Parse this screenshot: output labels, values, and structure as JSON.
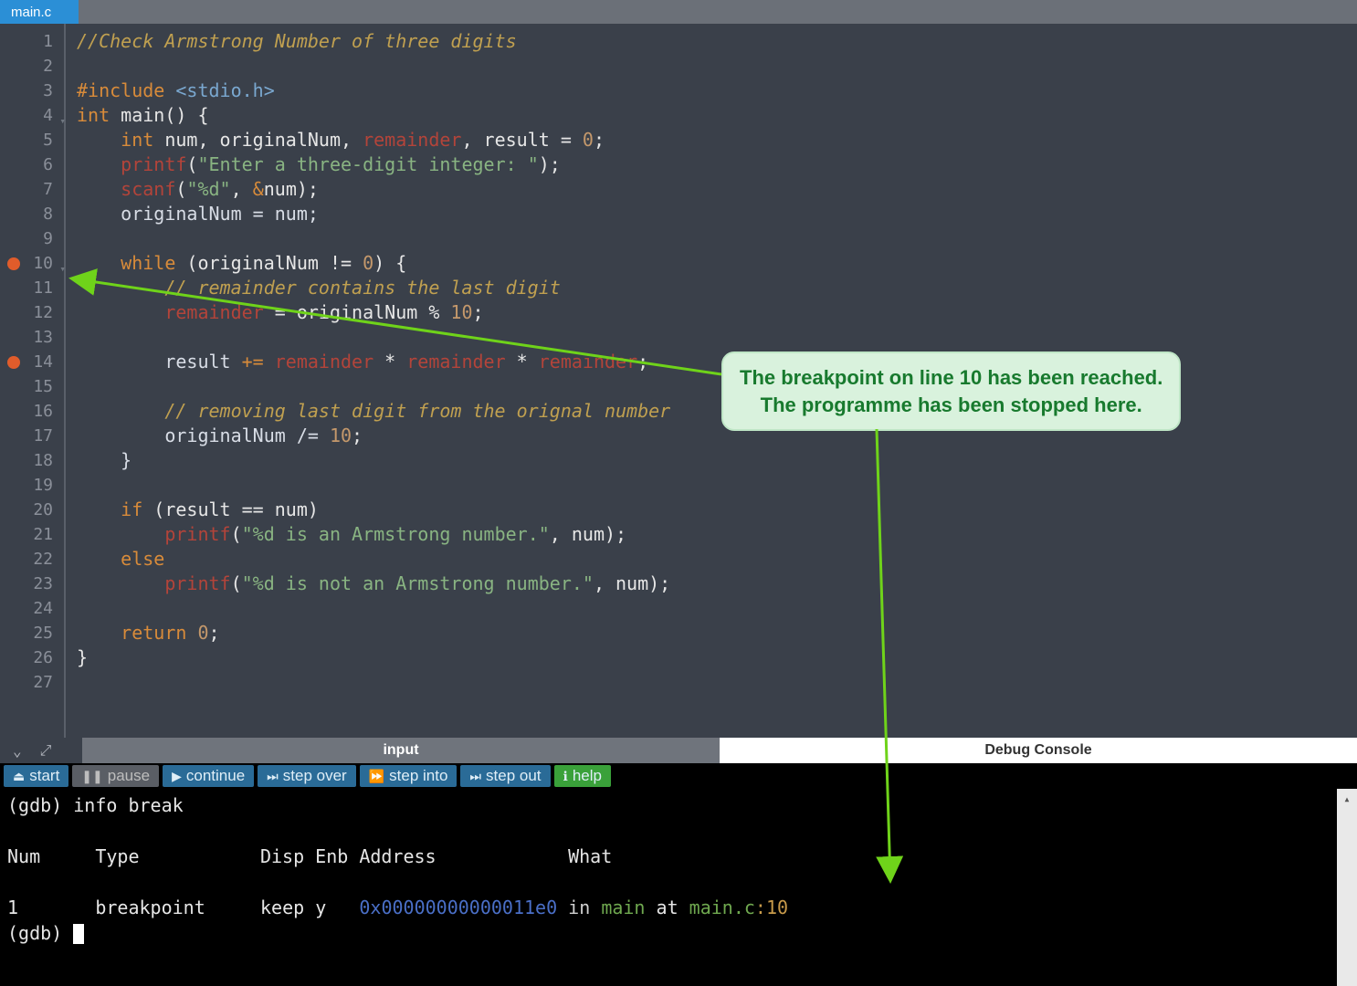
{
  "tab": {
    "filename": "main.c"
  },
  "code": {
    "lines": [
      {
        "n": 1,
        "segs": [
          [
            "c-comment",
            "//Check Armstrong Number of three digits"
          ]
        ]
      },
      {
        "n": 2,
        "segs": []
      },
      {
        "n": 3,
        "segs": [
          [
            "c-pp",
            "#include "
          ],
          [
            "c-ppfile",
            "<stdio.h>"
          ]
        ]
      },
      {
        "n": 4,
        "fold": true,
        "segs": [
          [
            "c-kw",
            "int "
          ],
          [
            "c-ident",
            "main() {"
          ]
        ]
      },
      {
        "n": 5,
        "segs": [
          [
            "",
            "    "
          ],
          [
            "c-kw",
            "int "
          ],
          [
            "c-ident",
            "num, originalNum, "
          ],
          [
            "c-red",
            "remainder"
          ],
          [
            "c-ident",
            ", result = "
          ],
          [
            "c-num",
            "0"
          ],
          [
            "c-ident",
            ";"
          ]
        ]
      },
      {
        "n": 6,
        "segs": [
          [
            "",
            "    "
          ],
          [
            "c-func",
            "printf"
          ],
          [
            "c-ident",
            "("
          ],
          [
            "c-str",
            "\"Enter a three-digit integer: \""
          ],
          [
            "c-ident",
            ");"
          ]
        ]
      },
      {
        "n": 7,
        "segs": [
          [
            "",
            "    "
          ],
          [
            "c-func",
            "scanf"
          ],
          [
            "c-ident",
            "("
          ],
          [
            "c-str",
            "\"%d\""
          ],
          [
            "c-ident",
            ", "
          ],
          [
            "c-op",
            "&"
          ],
          [
            "c-ident",
            "num);"
          ]
        ]
      },
      {
        "n": 8,
        "segs": [
          [
            "",
            "    originalNum = num;"
          ]
        ]
      },
      {
        "n": 9,
        "segs": []
      },
      {
        "n": 10,
        "bp": true,
        "fold": true,
        "segs": [
          [
            "",
            "    "
          ],
          [
            "c-kw",
            "while"
          ],
          [
            "c-ident",
            " (originalNum != "
          ],
          [
            "c-num",
            "0"
          ],
          [
            "c-ident",
            ") {"
          ]
        ]
      },
      {
        "n": 11,
        "segs": [
          [
            "",
            "        "
          ],
          [
            "c-comment",
            "// remainder contains the last digit"
          ]
        ]
      },
      {
        "n": 12,
        "segs": [
          [
            "",
            "        "
          ],
          [
            "c-red",
            "remainder"
          ],
          [
            "c-ident",
            " = originalNum % "
          ],
          [
            "c-num",
            "10"
          ],
          [
            "c-ident",
            ";"
          ]
        ]
      },
      {
        "n": 13,
        "segs": []
      },
      {
        "n": 14,
        "bp": true,
        "segs": [
          [
            "",
            "        result "
          ],
          [
            "c-op",
            "+="
          ],
          [
            "c-ident",
            " "
          ],
          [
            "c-red",
            "remainder"
          ],
          [
            "c-ident",
            " * "
          ],
          [
            "c-red",
            "remainder"
          ],
          [
            "c-ident",
            " * "
          ],
          [
            "c-red",
            "remainder"
          ],
          [
            "c-ident",
            ";"
          ]
        ]
      },
      {
        "n": 15,
        "segs": []
      },
      {
        "n": 16,
        "segs": [
          [
            "",
            "        "
          ],
          [
            "c-comment",
            "// removing last digit from the orignal number"
          ]
        ]
      },
      {
        "n": 17,
        "segs": [
          [
            "",
            "        originalNum /= "
          ],
          [
            "c-num",
            "10"
          ],
          [
            "c-ident",
            ";"
          ]
        ]
      },
      {
        "n": 18,
        "segs": [
          [
            "",
            "    }"
          ]
        ]
      },
      {
        "n": 19,
        "segs": []
      },
      {
        "n": 20,
        "segs": [
          [
            "",
            "    "
          ],
          [
            "c-kw",
            "if"
          ],
          [
            "c-ident",
            " (result == num)"
          ]
        ]
      },
      {
        "n": 21,
        "segs": [
          [
            "",
            "        "
          ],
          [
            "c-func",
            "printf"
          ],
          [
            "c-ident",
            "("
          ],
          [
            "c-str",
            "\"%d is an Armstrong number.\""
          ],
          [
            "c-ident",
            ", num);"
          ]
        ]
      },
      {
        "n": 22,
        "segs": [
          [
            "",
            "    "
          ],
          [
            "c-kw",
            "else"
          ]
        ]
      },
      {
        "n": 23,
        "segs": [
          [
            "",
            "        "
          ],
          [
            "c-func",
            "printf"
          ],
          [
            "c-ident",
            "("
          ],
          [
            "c-str",
            "\"%d is not an Armstrong number.\""
          ],
          [
            "c-ident",
            ", num);"
          ]
        ]
      },
      {
        "n": 24,
        "segs": []
      },
      {
        "n": 25,
        "segs": [
          [
            "",
            "    "
          ],
          [
            "c-kw",
            "return"
          ],
          [
            "c-ident",
            " "
          ],
          [
            "c-num",
            "0"
          ],
          [
            "c-ident",
            ";"
          ]
        ]
      },
      {
        "n": 26,
        "segs": [
          [
            "c-ident",
            "}"
          ]
        ]
      },
      {
        "n": 27,
        "segs": []
      }
    ]
  },
  "panels": {
    "input_label": "input",
    "debug_label": "Debug Console"
  },
  "dbg_buttons": {
    "start": "start",
    "pause": "pause",
    "continue": "continue",
    "step_over": "step over",
    "step_into": "step into",
    "step_out": "step out",
    "help": "help"
  },
  "console": {
    "line1_prompt": "(gdb) ",
    "line1_cmd": "info break",
    "header": "Num     Type           Disp Enb Address            What",
    "row_num": "1",
    "row_type": "breakpoint",
    "row_disp": "keep",
    "row_enb": "y",
    "row_addr": "0x00000000000011e0",
    "row_in": "in",
    "row_func": "main",
    "row_at": "at",
    "row_file": "main.c",
    "row_line": ":10",
    "line5_prompt": "(gdb) "
  },
  "annotation": {
    "line1": "The breakpoint on line 10 has been reached.",
    "line2": "The programme has been stopped here."
  }
}
